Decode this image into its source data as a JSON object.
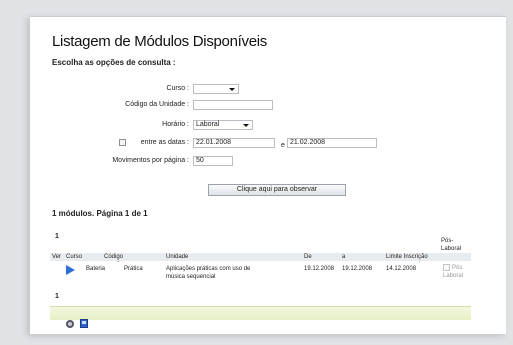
{
  "page": {
    "title": "Listagem de Módulos Disponíveis",
    "subtitle": "Escolha as opções de consulta :"
  },
  "form": {
    "curso": {
      "label": "Curso :",
      "value": ""
    },
    "codigo_unidade": {
      "label": "Código da Unidade :",
      "value": ""
    },
    "horario": {
      "label": "Horário :",
      "value": "Laboral"
    },
    "datas": {
      "label": "entre as datas :",
      "checked": false,
      "start": "22.01.2008",
      "connector": "e",
      "end": "21.02.2008"
    },
    "movimentos": {
      "label": "Movimentos por página :",
      "value": "50"
    },
    "observe_button": "Clique aqui para observar"
  },
  "results": {
    "summary": "1 módulos. Página 1 de 1",
    "pager_top": "1",
    "pager_bottom": "1",
    "columns": {
      "ver": "Ver",
      "curso": "Curso",
      "codigo": "Código",
      "unidade": "Unidade",
      "de": "De",
      "a": "a",
      "limite": "Limite Inscrição",
      "pos_laboral": [
        "Pós-",
        "Laboral"
      ]
    },
    "rows": [
      {
        "curso": "Bateria",
        "codigo": "Prática",
        "unidade": [
          "Aplicações práticas com uso de",
          "música sequencial"
        ],
        "de": "19.12.2008",
        "a": "19.12.2008",
        "limite": "14.12.2008",
        "pos_laboral_label": [
          "Pós",
          "Laboral"
        ],
        "pos_laboral_checked": false
      }
    ]
  },
  "footer": {
    "icons": [
      "pdf-export-icon",
      "excel-export-icon"
    ]
  },
  "colors": {
    "background": "#dfe3e6",
    "window": "#ffffff",
    "row_highlight": "#e9ecef",
    "footer_bar": "#e6efc4",
    "play_icon": "#2e6fd6"
  }
}
